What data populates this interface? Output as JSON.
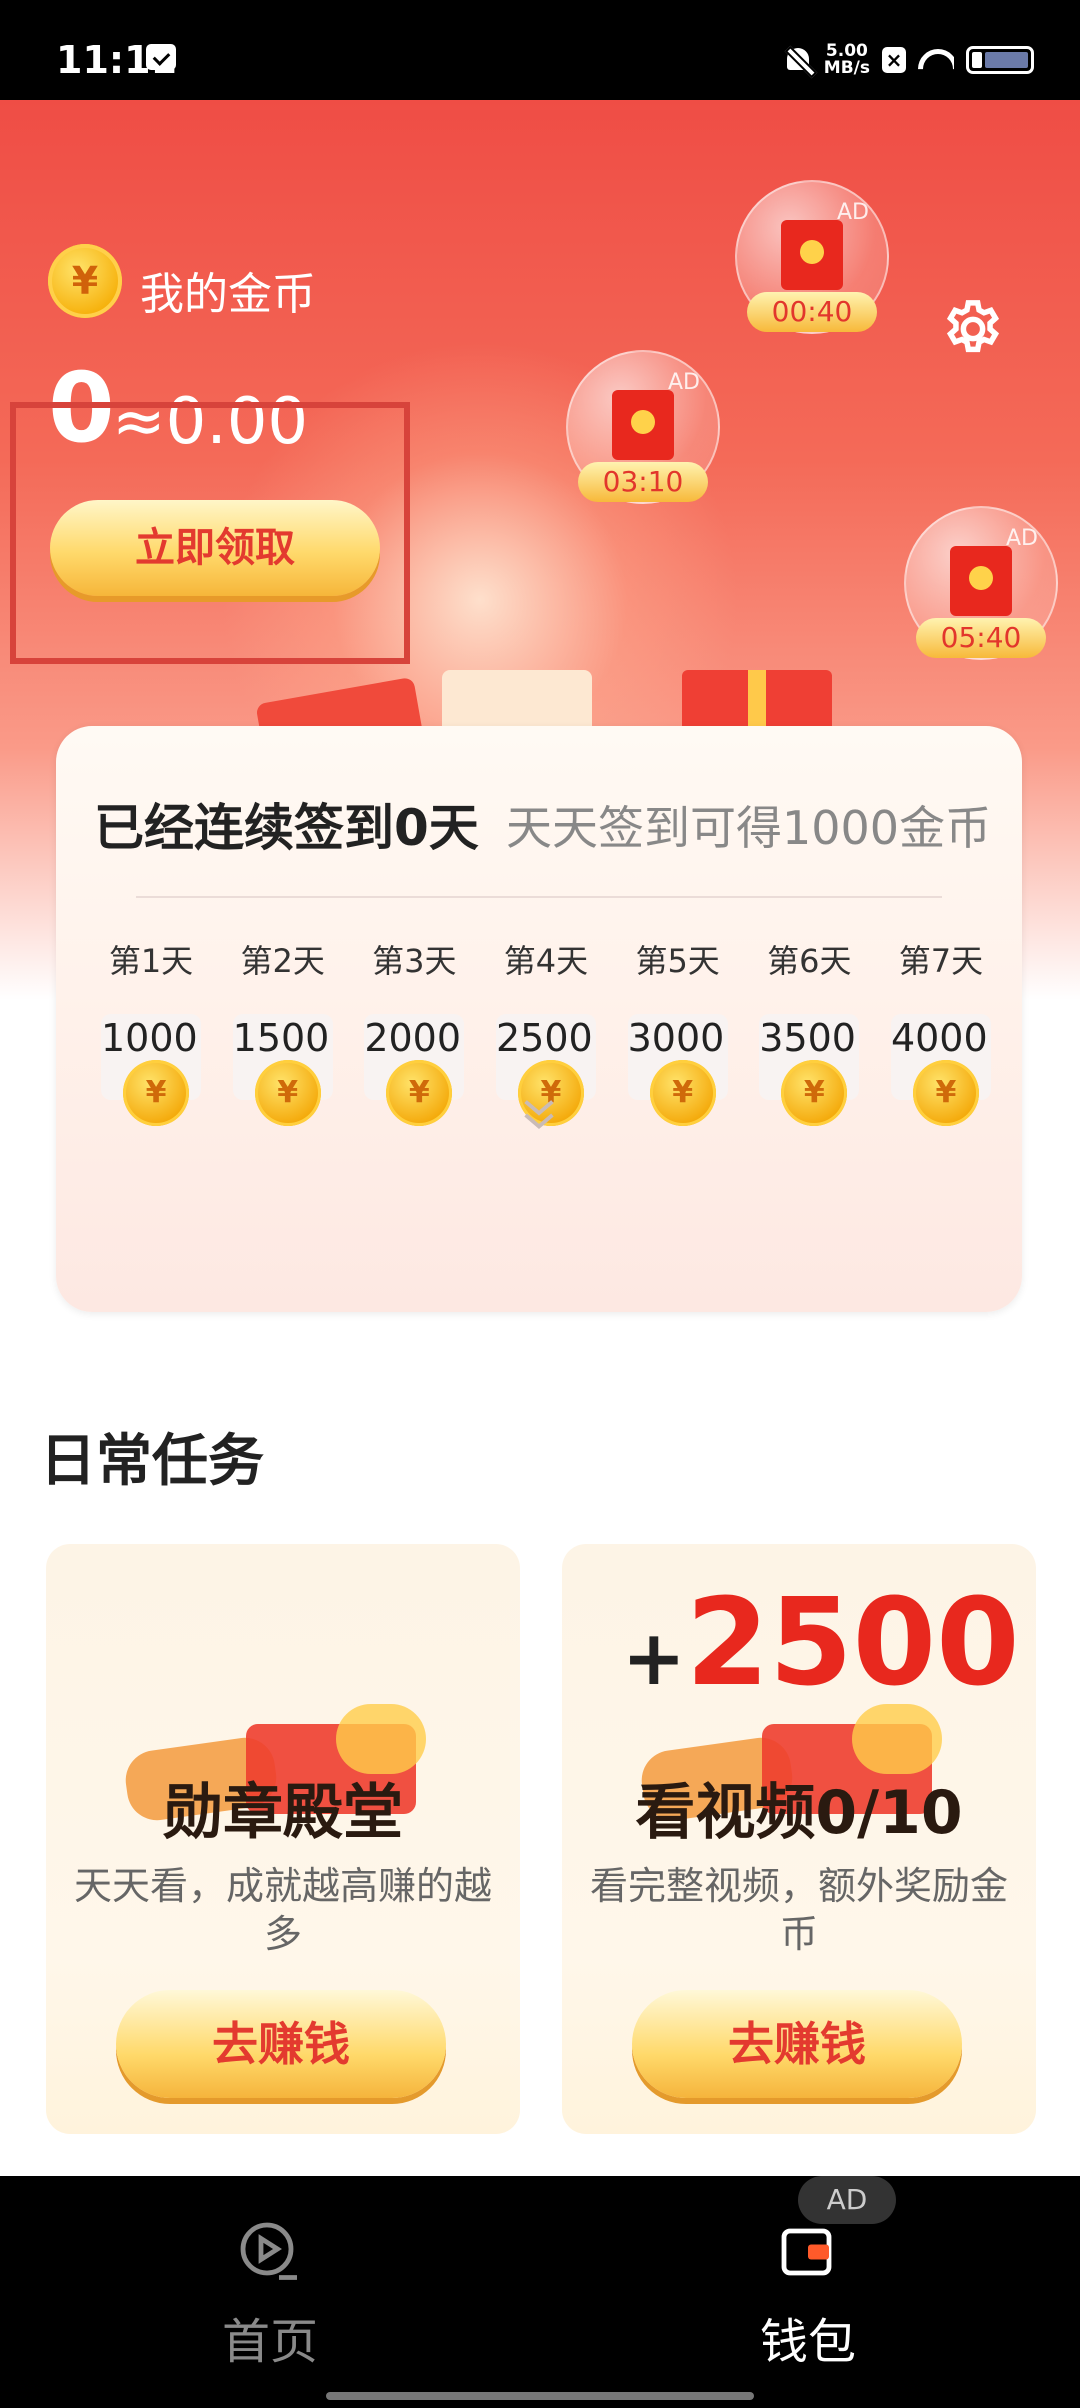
{
  "status_bar": {
    "time": "11:11",
    "net_speed_value": "5.00",
    "net_speed_unit": "MB/s"
  },
  "wallet": {
    "title": "我的金币",
    "coin_symbol": "¥",
    "balance": "0",
    "approx_value": "≈0.00",
    "claim_label": "立即领取"
  },
  "ad_bubbles": [
    {
      "timer": "00:40",
      "tag": "AD"
    },
    {
      "timer": "03:10",
      "tag": "AD"
    },
    {
      "timer": "05:40",
      "tag": "AD"
    }
  ],
  "checkin": {
    "title": "已经连续签到0天",
    "subtitle": "天天签到可得1000金币",
    "days": [
      {
        "label": "第1天",
        "amount": "1000"
      },
      {
        "label": "第2天",
        "amount": "1500"
      },
      {
        "label": "第3天",
        "amount": "2000"
      },
      {
        "label": "第4天",
        "amount": "2500"
      },
      {
        "label": "第5天",
        "amount": "3000"
      },
      {
        "label": "第6天",
        "amount": "3500"
      },
      {
        "label": "第7天",
        "amount": "4000"
      }
    ]
  },
  "daily_tasks": {
    "title": "日常任务",
    "cards": [
      {
        "name": "勋章殿堂",
        "desc": "天天看，成就越高赚的越多",
        "button": "去赚钱"
      },
      {
        "name": "看视频0/10",
        "desc": "看完整视频，额外奖励金币",
        "button": "去赚钱",
        "bonus_plus": "+",
        "bonus_amount": "2500"
      }
    ]
  },
  "bottom_nav": {
    "items": [
      {
        "label": "首页",
        "icon": "play-circle-icon"
      },
      {
        "label": "钱包",
        "icon": "wallet-icon"
      }
    ],
    "ad_badge": "AD"
  },
  "colors": {
    "accent_red": "#e8281e",
    "gold": "#f6b10c"
  }
}
